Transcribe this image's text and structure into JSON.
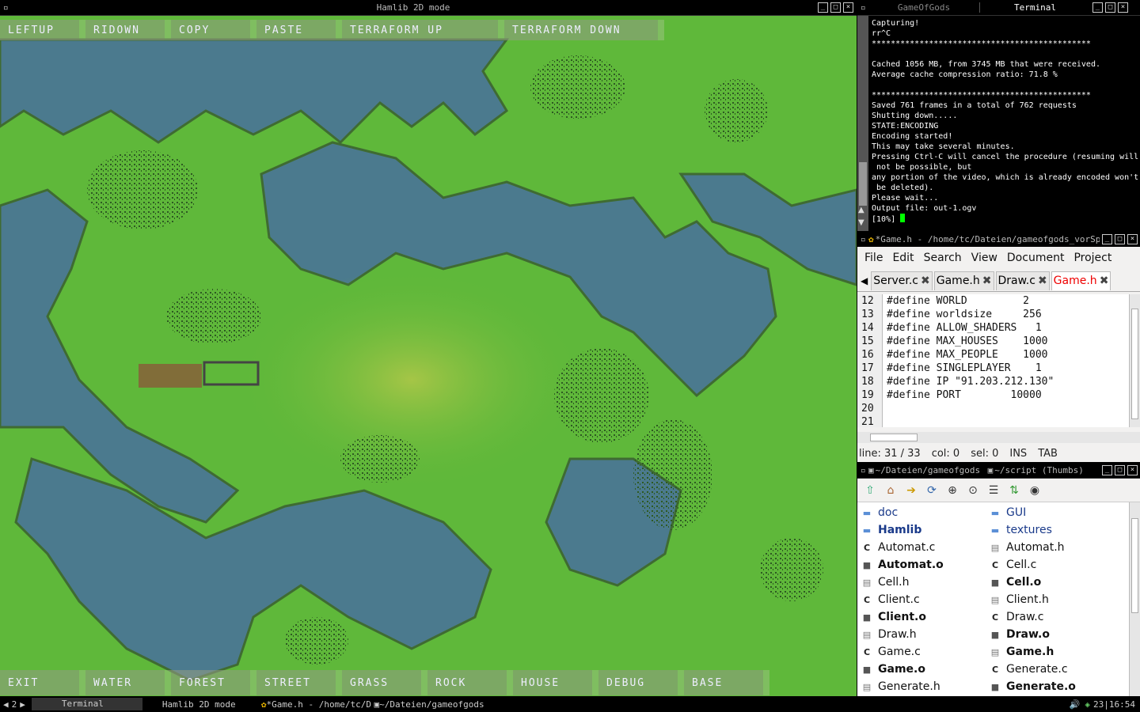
{
  "game_window": {
    "title": "Hamlib 2D mode"
  },
  "game": {
    "top_buttons": [
      "LEFTUP",
      "RIDOWN",
      "COPY",
      "PASTE",
      "TERRAFORM UP",
      "TERRAFORM DOWN"
    ],
    "bottom_buttons": [
      "EXIT",
      "WATER",
      "FOREST",
      "STREET",
      "GRASS",
      "ROCK",
      "HOUSE",
      "DEBUG",
      "BASE"
    ],
    "colors": {
      "grass": "#5fb83a",
      "water": "#4b7a8e",
      "forest": "#3b6a2a"
    }
  },
  "terminal_window": {
    "tab_inactive": "GameOfGods",
    "tab_active": "Terminal"
  },
  "terminal": {
    "lines": [
      "Capturing!",
      "rr^C",
      "**********************************************",
      "",
      "Cached 1056 MB, from 3745 MB that were received.",
      "Average cache compression ratio: 71.8 %",
      "",
      "**********************************************",
      "Saved 761 frames in a total of 762 requests",
      "Shutting down.....",
      "STATE:ENCODING",
      "Encoding started!",
      "This may take several minutes.",
      "Pressing Ctrl-C will cancel the procedure (resuming will",
      " not be possible, but",
      "any portion of the video, which is already encoded won't",
      " be deleted).",
      "Please wait...",
      "Output file: out-1.ogv",
      "[10%]"
    ]
  },
  "editor_window": {
    "title": "*Game.h - /home/tc/Dateien/gameofgods_vorSp"
  },
  "editor": {
    "menu": [
      "File",
      "Edit",
      "Search",
      "View",
      "Document",
      "Project"
    ],
    "tabs": [
      {
        "label": "Server.c",
        "active": false
      },
      {
        "label": "Game.h",
        "active": false
      },
      {
        "label": "Draw.c",
        "active": false
      },
      {
        "label": "Game.h",
        "active": true
      }
    ],
    "line_numbers": [
      "12",
      "13",
      "14",
      "15",
      "16",
      "17",
      "18",
      "19",
      "20",
      "21"
    ],
    "code": [
      "#define WORLD         2",
      "#define worldsize     256",
      "#define ALLOW_SHADERS   1",
      "#define MAX_HOUSES    1000",
      "#define MAX_PEOPLE    1000",
      "#define SINGLEPLAYER    1",
      "#define IP \"91.203.212.130\"",
      "#define PORT        10000",
      "",
      ""
    ],
    "status": {
      "line": "line: 31 / 33",
      "col": "col: 0",
      "sel": "sel: 0",
      "ins": "INS",
      "tab": "TAB"
    }
  },
  "fm_window": {
    "title_left": "~/Dateien/gameofgods",
    "title_right": "~/script (Thumbs)"
  },
  "file_manager": {
    "rows": [
      [
        {
          "name": "doc",
          "kind": "folder"
        },
        {
          "name": "GUI",
          "kind": "folder"
        }
      ],
      [
        {
          "name": "Hamlib",
          "kind": "folder-bold"
        },
        {
          "name": "textures",
          "kind": "folder"
        }
      ],
      [
        {
          "name": "Automat.c",
          "kind": "c"
        },
        {
          "name": "Automat.h",
          "kind": "h"
        }
      ],
      [
        {
          "name": "Automat.o",
          "kind": "o"
        },
        {
          "name": "Cell.c",
          "kind": "c"
        }
      ],
      [
        {
          "name": "Cell.h",
          "kind": "h"
        },
        {
          "name": "Cell.o",
          "kind": "o"
        }
      ],
      [
        {
          "name": "Client.c",
          "kind": "c"
        },
        {
          "name": "Client.h",
          "kind": "h"
        }
      ],
      [
        {
          "name": "Client.o",
          "kind": "o"
        },
        {
          "name": "Draw.c",
          "kind": "c"
        }
      ],
      [
        {
          "name": "Draw.h",
          "kind": "h"
        },
        {
          "name": "Draw.o",
          "kind": "o"
        }
      ],
      [
        {
          "name": "Game.c",
          "kind": "c"
        },
        {
          "name": "Game.h",
          "kind": "h-bold"
        }
      ],
      [
        {
          "name": "Game.o",
          "kind": "o"
        },
        {
          "name": "Generate.c",
          "kind": "c"
        }
      ],
      [
        {
          "name": "Generate.h",
          "kind": "h"
        },
        {
          "name": "Generate.o",
          "kind": "o"
        }
      ]
    ]
  },
  "taskbar": {
    "desktop": "2",
    "items": [
      "Terminal",
      "Hamlib 2D mode",
      "*Game.h - /home/tc/D",
      "~/Dateien/gameofgods"
    ],
    "clock": "23|16:54"
  }
}
